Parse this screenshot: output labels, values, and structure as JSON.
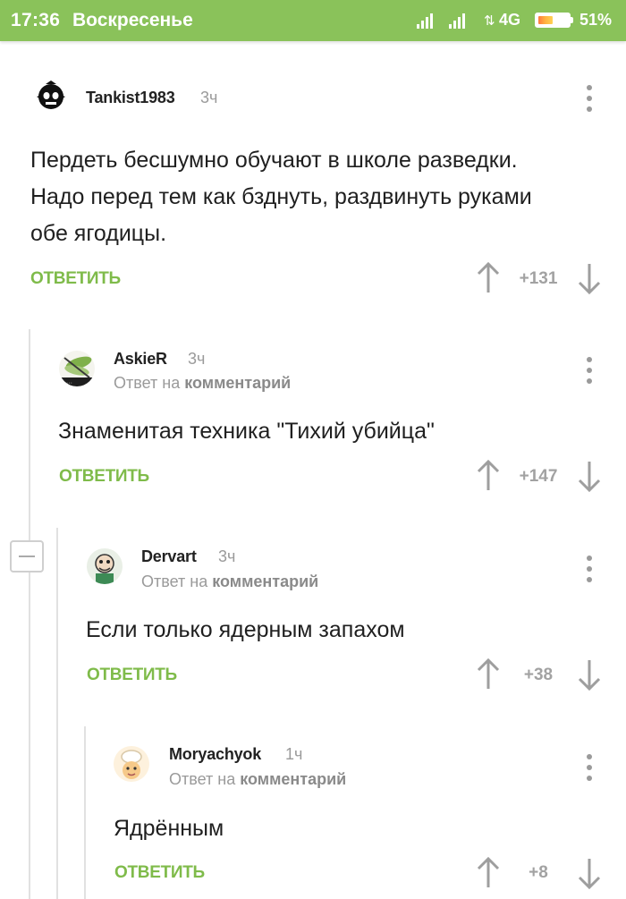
{
  "status_bar": {
    "time": "17:36",
    "day": "Воскресенье",
    "network": "4G",
    "battery_percent_label": "51%",
    "battery_level": 0.51
  },
  "comments": [
    {
      "username": "Tankist1983",
      "time": "3ч",
      "reply_prefix": "",
      "reply_target": "",
      "text_lines": [
        "Пердеть бесшумно обучают в школе разведки.",
        "Надо перед тем как бзднуть, раздвинуть руками",
        "обе ягодицы."
      ],
      "reply_label": "ОТВЕТИТЬ",
      "rating": "+131",
      "avatar_icon": "helmet-skull-icon"
    },
    {
      "username": "AskieR",
      "time": "3ч",
      "reply_prefix": "Ответ на ",
      "reply_target": "комментарий",
      "text_lines": [
        "Знаменитая техника \"Тихий убийца\""
      ],
      "reply_label": "ОТВЕТИТЬ",
      "rating": "+147",
      "avatar_icon": "dragonfly-icon"
    },
    {
      "username": "Dervart",
      "time": "3ч",
      "reply_prefix": "Ответ на ",
      "reply_target": "комментарий",
      "text_lines": [
        "Если только ядерным запахом"
      ],
      "reply_label": "ОТВЕТИТЬ",
      "rating": "+38",
      "avatar_icon": "cartoon-character-icon"
    },
    {
      "username": "Moryachyok",
      "time": "1ч",
      "reply_prefix": "Ответ на ",
      "reply_target": "комментарий",
      "text_lines": [
        "Ядрённым"
      ],
      "reply_label": "ОТВЕТИТЬ",
      "rating": "+8",
      "avatar_icon": "chef-hat-icon"
    }
  ],
  "colors": {
    "status_bar": "#8ac25a",
    "reply_green": "#7fbb4a",
    "muted_gray": "#9a9a9a"
  }
}
